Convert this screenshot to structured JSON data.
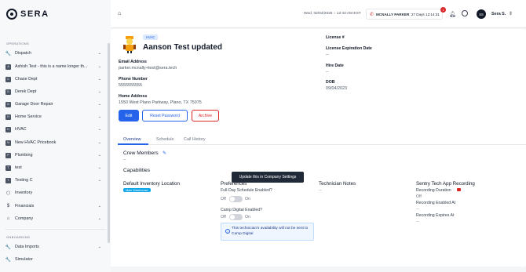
{
  "brand": {
    "name": "SERA"
  },
  "sidebar": {
    "operations_label": "OPERATIONS",
    "onboarding_label": "ONBOARDING",
    "items": [
      {
        "label": "Dispatch",
        "icon": "wrench-icon"
      },
      {
        "label": "Ashish Test - this is a name longer th...",
        "badge": "A"
      },
      {
        "label": "Chase Dept",
        "badge": "C"
      },
      {
        "label": "Derek Dept",
        "badge": "D"
      },
      {
        "label": "Garage Door Repair",
        "badge": "G"
      },
      {
        "label": "Home Service",
        "badge": "H"
      },
      {
        "label": "HVAC",
        "badge": "H"
      },
      {
        "label": "New HVAC Pricebook",
        "badge": "N"
      },
      {
        "label": "Plumbing",
        "badge": "P"
      },
      {
        "label": "test",
        "badge": "T"
      },
      {
        "label": "Testing C",
        "badge": "T"
      },
      {
        "label": "Inventory",
        "icon": "box-icon"
      },
      {
        "label": "Financials",
        "icon": "dollar-icon"
      },
      {
        "label": "Company",
        "icon": "building-icon"
      }
    ],
    "onboarding_items": [
      {
        "label": "Data Imports",
        "icon": "wrench-icon"
      },
      {
        "label": "Simulator",
        "icon": "wrench-icon"
      }
    ]
  },
  "header": {
    "datetime": "Wed, 02/04/2026 :: 12:43 AM EST",
    "timer_name": "MCNALLY PARKER",
    "timer_text": ": 27 Days 12:14:31",
    "notification_count": "1",
    "avatar_initials": "SS",
    "user_name": "Sera S."
  },
  "profile": {
    "trade_badge": "HVAC",
    "name": "Aanson Test updated",
    "email_label": "Email Address",
    "email": "parker.mcnally+test@sera.tech",
    "phone_label": "Phone Number",
    "phone": "5555555555",
    "address_label": "Home Address",
    "address": "1550 West Plano Parkway, Plano, TX 75075",
    "license_label": "License #",
    "license_exp_label": "License Expiration Date",
    "license_exp": "--",
    "hire_label": "Hire Date",
    "hire": "--",
    "dob_label": "DOB",
    "dob": "09/04/2023",
    "edit_label": "Edit",
    "reset_label": "Reset Password",
    "archive_label": "Archive"
  },
  "tabs": [
    "Overview",
    "Schedule",
    "Call History"
  ],
  "overview": {
    "crew_title": "Crew Members",
    "crew_value": "--",
    "capabilities_title": "Capabilities",
    "inventory_title": "Default Inventory Location",
    "inventory_badge": "Main Warehouse",
    "preferences_title": "Preferences",
    "fullday_label": "Full-Day Schedule Enabled?",
    "off": "Off",
    "on": "On",
    "campdigital_label": "Camp Digital Enabled?",
    "info_text": "This technician's availability will not be sent to Camp Digital",
    "tooltip": "Update this in Company Settings",
    "notes_title": "Technician Notes",
    "notes_value": "--",
    "recording_title": "Sentry Tech App Recording",
    "rec_duration_label": "Recording Duration",
    "rec_duration_value": "Off",
    "rec_enabled_label": "Recording Enabled At",
    "rec_enabled_value": "--",
    "rec_expires_label": "Recording Expires At",
    "rec_expires_value": "--"
  }
}
